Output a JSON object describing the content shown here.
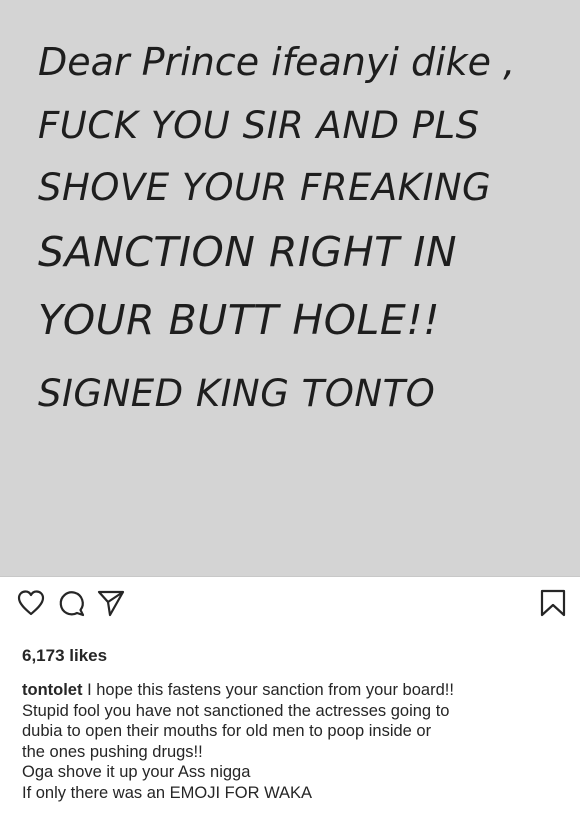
{
  "post": {
    "image_text": [
      "Dear Prince ifeanyi dike ,",
      "FUCK YOU SIR AND PLS",
      "SHOVE YOUR FREAKING",
      "SANCTION RIGHT IN",
      "YOUR BUTT HOLE!!",
      "SIGNED KING TONTO"
    ],
    "likes": "6,173 likes",
    "username": "tontolet",
    "caption_first": " I hope this fastens your sanction from your board!!",
    "caption_lines": [
      "Stupid fool you have not sanctioned the actresses going to",
      "dubia to open their mouths for old men to poop inside or",
      "the ones pushing drugs!!",
      "Oga shove it up your Ass nigga",
      "If only there was an EMOJI FOR WAKA"
    ]
  },
  "icons": {
    "like": "heart-icon",
    "comment": "comment-icon",
    "share": "share-icon",
    "save": "bookmark-icon"
  }
}
